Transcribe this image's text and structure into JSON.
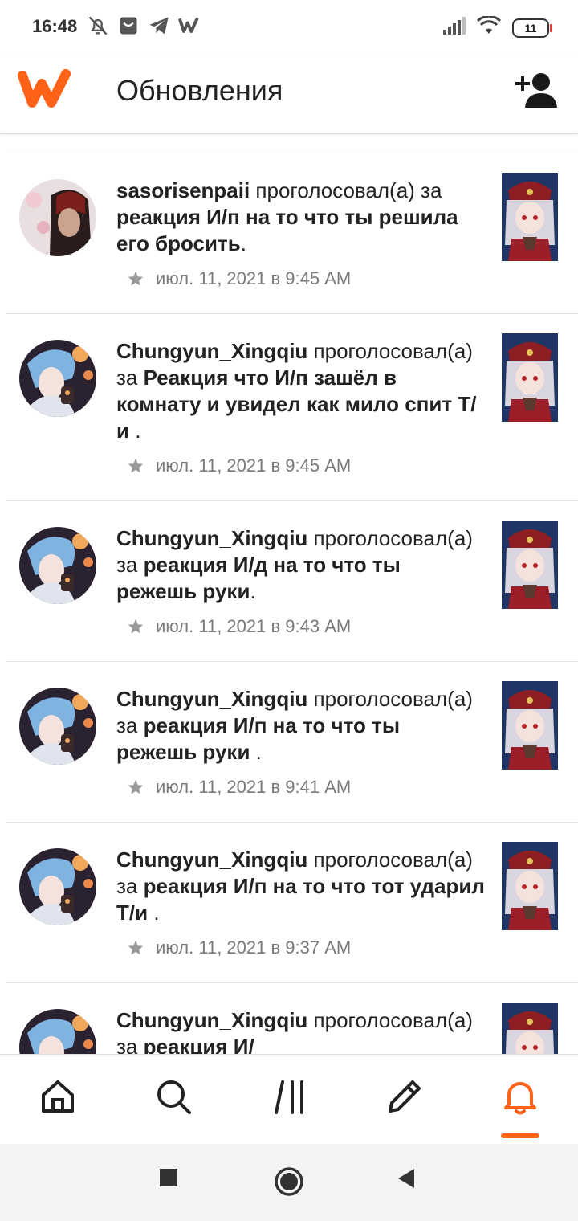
{
  "status_bar": {
    "time": "16:48",
    "battery": "11",
    "icons": [
      "bell-off-icon",
      "shop-icon",
      "telegram-icon",
      "wattpad-icon",
      "signal-icon",
      "wifi-icon"
    ]
  },
  "header": {
    "title": "Обновления",
    "logo": "wattpad-logo",
    "action_icon": "add-friend-icon"
  },
  "accent_color": "#ff6116",
  "feed": [
    {
      "user": "sasorisenpaii",
      "action": " проголосовал(а) за ",
      "story": "реакция И/п на то что ты решила его бросить",
      "suffix": ".",
      "timestamp": "июл. 11, 2021 в 9:45 AM"
    },
    {
      "user": "Chungyun_Xingqiu",
      "action": " проголосовал(а) за ",
      "story": "Реакция что И/п зашёл в комнату и увидел как мило спит Т/и",
      "suffix": " .",
      "timestamp": "июл. 11, 2021 в 9:45 AM"
    },
    {
      "user": "Chungyun_Xingqiu",
      "action": " проголосовал(а) за ",
      "story": "реакция И/д на то что ты режешь руки",
      "suffix": ".",
      "timestamp": "июл. 11, 2021 в 9:43 AM"
    },
    {
      "user": "Chungyun_Xingqiu",
      "action": " проголосовал(а) за ",
      "story": "реакция И/п на то что ты режешь руки",
      "suffix": " .",
      "timestamp": "июл. 11, 2021 в 9:41 AM"
    },
    {
      "user": "Chungyun_Xingqiu",
      "action": " проголосовал(а) за ",
      "story": "реакция И/п на то что тот ударил Т/и",
      "suffix": " .",
      "timestamp": "июл. 11, 2021 в 9:37 AM"
    },
    {
      "user": "Chungyun_Xingqiu",
      "action": " проголосовал(а) за ",
      "story": "реакция И/",
      "suffix": "",
      "timestamp": ""
    }
  ],
  "bottom_nav": {
    "items": [
      "home-icon",
      "search-icon",
      "library-icon",
      "write-icon",
      "notifications-icon"
    ],
    "active": "notifications-icon"
  },
  "system_nav": [
    "recents-button",
    "home-button",
    "back-button"
  ]
}
